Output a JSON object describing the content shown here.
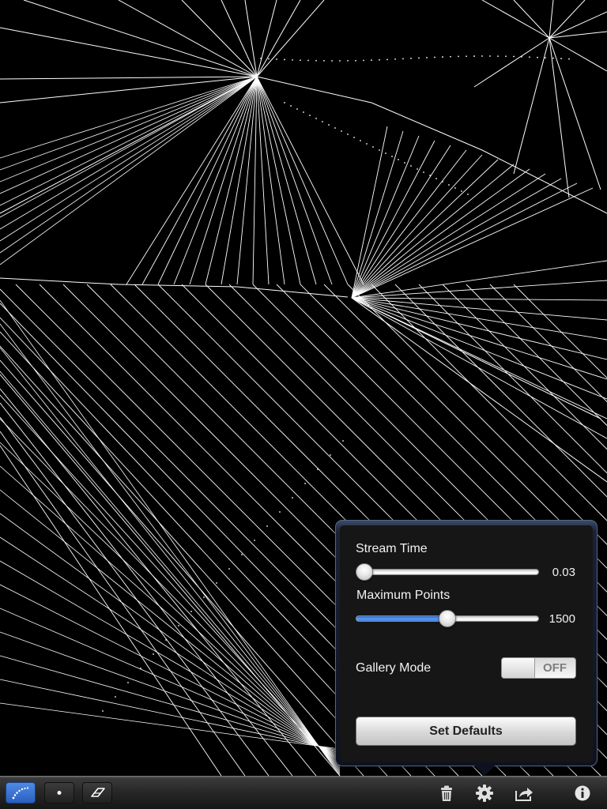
{
  "canvas": {
    "background_color": "#000000",
    "stroke_color": "#ffffff"
  },
  "settings_popover": {
    "stream_time": {
      "label": "Stream Time",
      "value": "0.03",
      "fraction": 0.0
    },
    "maximum_points": {
      "label": "Maximum Points",
      "value": "1500",
      "fraction": 0.5
    },
    "gallery_mode": {
      "label": "Gallery Mode",
      "state": "OFF"
    },
    "set_defaults_label": "Set Defaults"
  },
  "toolbar": {
    "tools": [
      {
        "icon": "stream-brush-icon",
        "selected": true
      },
      {
        "icon": "dot-brush-icon",
        "selected": false
      },
      {
        "icon": "eraser-icon",
        "selected": false
      }
    ],
    "actions": [
      "trash-icon",
      "gear-icon",
      "share-icon",
      "info-icon"
    ],
    "accent_color": "#3f7fe0"
  }
}
